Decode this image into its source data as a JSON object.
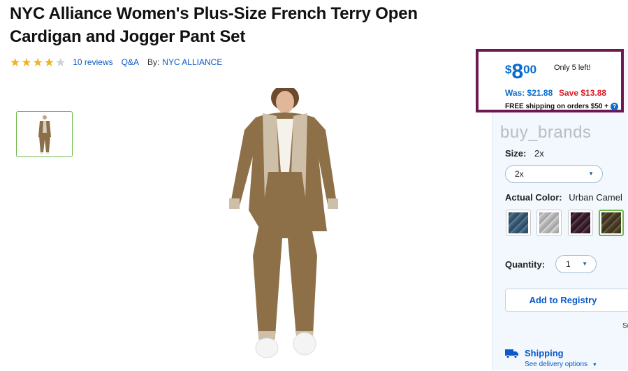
{
  "product": {
    "title": "NYC Alliance Women's Plus-Size French Terry Open Cardigan and Jogger Pant Set",
    "rating": 4,
    "rating_max": 5,
    "reviews_link": "10 reviews",
    "qa_link": "Q&A",
    "by_label": "By:",
    "brand_link": "NYC ALLIANCE"
  },
  "price_box": {
    "currency": "$",
    "dollars": "8",
    "cents": "00",
    "stock_note": "Only 5 left!",
    "was": "Was: $21.88",
    "save": "Save $13.88",
    "shipping_note": "FREE shipping on orders $50 +",
    "help_icon": "?"
  },
  "watermark": "buy_brands",
  "options": {
    "size_label": "Size:",
    "size_value": "2x",
    "size_selected": "2x",
    "color_label": "Actual Color:",
    "color_value": "Urban Camel",
    "swatches": [
      {
        "name": "blue-heather",
        "color": "#3d5f7a",
        "selected": false
      },
      {
        "name": "grey-heather",
        "color": "#b9b9b9",
        "selected": false
      },
      {
        "name": "plum-heather",
        "color": "#3b2530",
        "selected": false
      },
      {
        "name": "urban-camel",
        "color": "#4a4028",
        "selected": true
      }
    ],
    "quantity_label": "Quantity:",
    "quantity_value": "1"
  },
  "actions": {
    "registry_label": "Add to Registry",
    "cut_text": "S("
  },
  "shipping": {
    "label": "Shipping",
    "delivery_link": "See delivery options"
  },
  "colors": {
    "accent_blue": "#0a6ccf",
    "save_red": "#de1c24",
    "price_box_border": "#6e1851",
    "selected_green": "#6bb845",
    "star_gold": "#f0b323"
  }
}
